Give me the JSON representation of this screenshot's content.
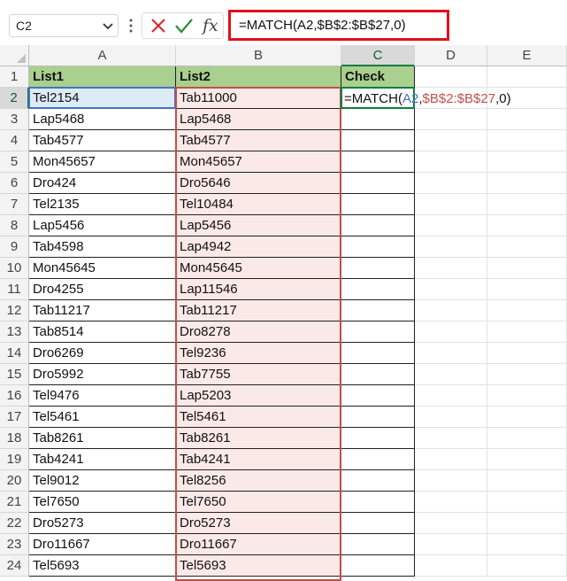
{
  "name_box": {
    "value": "C2"
  },
  "formula_bar": {
    "fx_label": "fx",
    "formula": "=MATCH(A2,$B$2:$B$27,0)"
  },
  "active_cell_formula": {
    "prefix": "=MATCH(",
    "ref_a": "A2",
    "sep1": ",",
    "ref_b": "$B$2:$B$27",
    "suffix": ",0)"
  },
  "columns": [
    "A",
    "B",
    "C",
    "D",
    "E"
  ],
  "rows": [
    "1",
    "2",
    "3",
    "4",
    "5",
    "6",
    "7",
    "8",
    "9",
    "10",
    "11",
    "12",
    "13",
    "14",
    "15",
    "16",
    "17",
    "18",
    "19",
    "20",
    "21",
    "22",
    "23",
    "24"
  ],
  "headers": {
    "a": "List1",
    "b": "List2",
    "c": "Check"
  },
  "list1": [
    "Tel2154",
    "Lap5468",
    "Tab4577",
    "Mon45657",
    "Dro424",
    "Tel2135",
    "Lap5456",
    "Tab4598",
    "Mon45645",
    "Dro4255",
    "Tab11217",
    "Tab8514",
    "Dro6269",
    "Dro5992",
    "Tel9476",
    "Tel5461",
    "Tab8261",
    "Tab4241",
    "Tel9012",
    "Tel7650",
    "Dro5273",
    "Dro11667",
    "Tel5693"
  ],
  "list2": [
    "Tab11000",
    "Lap5468",
    "Tab4577",
    "Mon45657",
    "Dro5646",
    "Tel10484",
    "Lap5456",
    "Lap4942",
    "Mon45645",
    "Lap11546",
    "Tab11217",
    "Dro8278",
    "Tel9236",
    "Tab7755",
    "Lap5203",
    "Tel5461",
    "Tab8261",
    "Tab4241",
    "Tel8256",
    "Tel7650",
    "Dro5273",
    "Dro11667",
    "Tel5693"
  ],
  "colors": {
    "header_fill": "#a9d08e",
    "list2_fill": "#fbe9e8",
    "ref_a_border": "#4472c4",
    "ref_b_border": "#c0504d",
    "active_border": "#107c41",
    "highlight_box": "#e0101c"
  }
}
